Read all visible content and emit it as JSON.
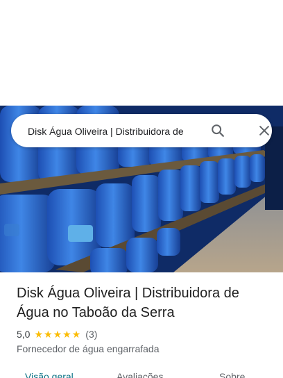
{
  "search": {
    "query": "Disk Água Oliveira | Distribuidora de"
  },
  "place": {
    "title_line1": "Disk Água Oliveira | Distribuidora de",
    "title_line2": "Água no Taboão da Serra",
    "rating": "5,0",
    "stars": 5,
    "review_count": "(3)",
    "category": "Fornecedor de água engarrafada"
  },
  "tabs": [
    {
      "label": "Visão geral",
      "active": true
    },
    {
      "label": "Avaliações",
      "active": false
    },
    {
      "label": "Sobre",
      "active": false
    }
  ],
  "icons": {
    "search": "search-icon",
    "close": "close-icon",
    "star": "star-icon"
  },
  "colors": {
    "accent_tab": "#0b7285",
    "star": "#fbbc04",
    "text_primary": "#1f1f1f",
    "text_secondary": "#5f6368"
  }
}
